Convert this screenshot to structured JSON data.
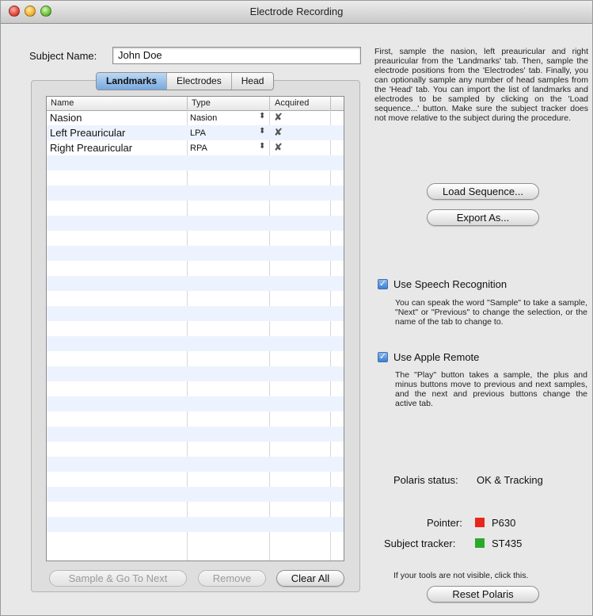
{
  "window": {
    "title": "Electrode Recording"
  },
  "subject": {
    "label": "Subject Name:",
    "value": "John Doe"
  },
  "tabs": [
    {
      "label": "Landmarks",
      "active": true
    },
    {
      "label": "Electrodes",
      "active": false
    },
    {
      "label": "Head",
      "active": false
    }
  ],
  "table": {
    "headers": {
      "name": "Name",
      "type": "Type",
      "acquired": "Acquired"
    },
    "rows": [
      {
        "name": "Nasion",
        "type": "Nasion",
        "stepper": "⬍",
        "acquired": "✘"
      },
      {
        "name": "Left Preauricular",
        "type": "LPA",
        "stepper": "⬍",
        "acquired": "✘"
      },
      {
        "name": "Right Preauricular",
        "type": "RPA",
        "stepper": "⬍",
        "acquired": "✘"
      }
    ]
  },
  "buttons": {
    "sample_next": "Sample & Go To Next",
    "remove": "Remove",
    "clear_all": "Clear All",
    "load_sequence": "Load Sequence...",
    "export_as": "Export As...",
    "reset_polaris": "Reset Polaris"
  },
  "instructions": "First, sample the nasion, left preauricular and right preauricular from the 'Landmarks' tab. Then, sample the electrode positions from the 'Electrodes' tab. Finally, you can optionally sample any number of head samples from the 'Head' tab. You can import the list of landmarks and electrodes to be sampled by clicking on the 'Load sequence...' button. Make sure the subject tracker does not move relative to the subject during the procedure.",
  "speech": {
    "label": "Use Speech Recognition",
    "checked": true,
    "description": "You can speak the word \"Sample\" to take a sample, \"Next\" or \"Previous\" to change the selection, or the name of the tab to change to."
  },
  "remote": {
    "label": "Use Apple Remote",
    "checked": true,
    "description": "The \"Play\" button takes a sample, the plus and minus buttons move to previous and next samples, and the next and previous buttons change the active tab."
  },
  "polaris": {
    "status_label": "Polaris status:",
    "status_value": "OK & Tracking",
    "pointer_label": "Pointer:",
    "pointer_id": "P630",
    "pointer_color": "#e8261b",
    "tracker_label": "Subject tracker:",
    "tracker_id": "ST435",
    "tracker_color": "#2ca82c",
    "hint": "If your tools are not visible, click this."
  }
}
